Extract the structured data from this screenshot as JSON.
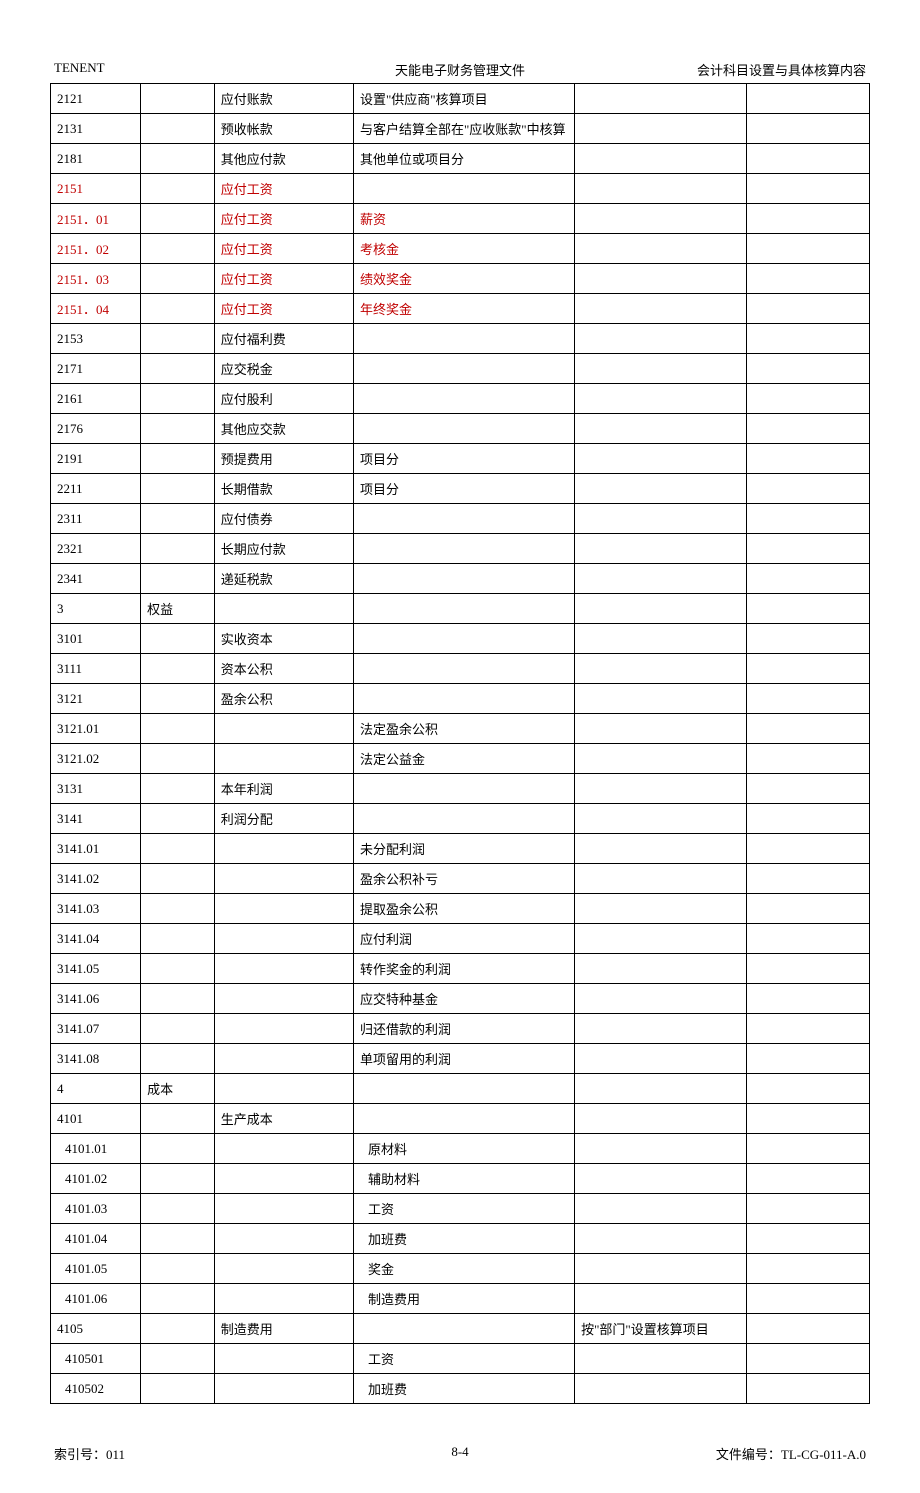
{
  "header": {
    "left": "TENENT",
    "center": "天能电子财务管理文件",
    "right": "会计科目设置与具体核算内容"
  },
  "footer": {
    "left": "索引号：011",
    "center": "8-4",
    "right": "文件编号：TL-CG-011-A.0"
  },
  "rows": [
    {
      "code": "2121",
      "cat": "",
      "name": "应付账款",
      "detail": "设置\"供应商\"核算项目",
      "note": "",
      "blank": ""
    },
    {
      "code": "2131",
      "cat": "",
      "name": "预收帐款",
      "detail": "与客户结算全部在\"应收账款\"中核算",
      "note": "",
      "blank": ""
    },
    {
      "code": "2181",
      "cat": "",
      "name": "其他应付款",
      "detail": "其他单位或项目分",
      "note": "",
      "blank": ""
    },
    {
      "code": "2151",
      "cat": "",
      "name": "应付工资",
      "detail": "",
      "note": "",
      "blank": "",
      "red": true
    },
    {
      "code": "2151．01",
      "cat": "",
      "name": "应付工资",
      "detail": "薪资",
      "note": "",
      "blank": "",
      "red": true
    },
    {
      "code": "2151．02",
      "cat": "",
      "name": "应付工资",
      "detail": "考核金",
      "note": "",
      "blank": "",
      "red": true
    },
    {
      "code": "2151．03",
      "cat": "",
      "name": "应付工资",
      "detail": "绩效奖金",
      "note": "",
      "blank": "",
      "red": true
    },
    {
      "code": "2151．04",
      "cat": "",
      "name": "应付工资",
      "detail": "年终奖金",
      "note": "",
      "blank": "",
      "red": true
    },
    {
      "code": "2153",
      "cat": "",
      "name": "应付福利费",
      "detail": "",
      "note": "",
      "blank": ""
    },
    {
      "code": "2171",
      "cat": "",
      "name": "应交税金",
      "detail": "",
      "note": "",
      "blank": ""
    },
    {
      "code": "2161",
      "cat": "",
      "name": "应付股利",
      "detail": "",
      "note": "",
      "blank": ""
    },
    {
      "code": "2176",
      "cat": "",
      "name": "其他应交款",
      "detail": "",
      "note": "",
      "blank": ""
    },
    {
      "code": "2191",
      "cat": "",
      "name": "预提费用",
      "detail": "项目分",
      "note": "",
      "blank": ""
    },
    {
      "code": "2211",
      "cat": "",
      "name": "长期借款",
      "detail": "项目分",
      "note": "",
      "blank": ""
    },
    {
      "code": "2311",
      "cat": "",
      "name": "应付债券",
      "detail": "",
      "note": "",
      "blank": ""
    },
    {
      "code": "2321",
      "cat": "",
      "name": "长期应付款",
      "detail": "",
      "note": "",
      "blank": ""
    },
    {
      "code": "2341",
      "cat": "",
      "name": "递延税款",
      "detail": "",
      "note": "",
      "blank": ""
    },
    {
      "code": "3",
      "cat": "权益",
      "name": "",
      "detail": "",
      "note": "",
      "blank": ""
    },
    {
      "code": "3101",
      "cat": "",
      "name": "实收资本",
      "detail": "",
      "note": "",
      "blank": ""
    },
    {
      "code": "3111",
      "cat": "",
      "name": "资本公积",
      "detail": "",
      "note": "",
      "blank": ""
    },
    {
      "code": "3121",
      "cat": "",
      "name": "盈余公积",
      "detail": "",
      "note": "",
      "blank": ""
    },
    {
      "code": "3121.01",
      "cat": "",
      "name": "",
      "detail": "法定盈余公积",
      "note": "",
      "blank": ""
    },
    {
      "code": "3121.02",
      "cat": "",
      "name": "",
      "detail": "法定公益金",
      "note": "",
      "blank": ""
    },
    {
      "code": "3131",
      "cat": "",
      "name": "本年利润",
      "detail": "",
      "note": "",
      "blank": ""
    },
    {
      "code": "3141",
      "cat": "",
      "name": "利润分配",
      "detail": "",
      "note": "",
      "blank": ""
    },
    {
      "code": "3141.01",
      "cat": "",
      "name": "",
      "detail": "未分配利润",
      "note": "",
      "blank": ""
    },
    {
      "code": "3141.02",
      "cat": "",
      "name": "",
      "detail": "盈余公积补亏",
      "note": "",
      "blank": ""
    },
    {
      "code": "3141.03",
      "cat": "",
      "name": "",
      "detail": "提取盈余公积",
      "note": "",
      "blank": ""
    },
    {
      "code": "3141.04",
      "cat": "",
      "name": "",
      "detail": "应付利润",
      "note": "",
      "blank": ""
    },
    {
      "code": "3141.05",
      "cat": "",
      "name": "",
      "detail": "转作奖金的利润",
      "note": "",
      "blank": ""
    },
    {
      "code": "3141.06",
      "cat": "",
      "name": "",
      "detail": "应交特种基金",
      "note": "",
      "blank": ""
    },
    {
      "code": "3141.07",
      "cat": "",
      "name": "",
      "detail": "归还借款的利润",
      "note": "",
      "blank": ""
    },
    {
      "code": "3141.08",
      "cat": "",
      "name": "",
      "detail": "单项留用的利润",
      "note": "",
      "blank": ""
    },
    {
      "code": "4",
      "cat": "成本",
      "name": "",
      "detail": "",
      "note": "",
      "blank": ""
    },
    {
      "code": "4101",
      "cat": "",
      "name": "生产成本",
      "detail": "",
      "note": "",
      "blank": ""
    },
    {
      "code": "4101.01",
      "cat": "",
      "name": "",
      "detail": "原材料",
      "note": "",
      "blank": "",
      "indent": true
    },
    {
      "code": "4101.02",
      "cat": "",
      "name": "",
      "detail": "辅助材料",
      "note": "",
      "blank": "",
      "indent": true
    },
    {
      "code": "4101.03",
      "cat": "",
      "name": "",
      "detail": "工资",
      "note": "",
      "blank": "",
      "indent": true
    },
    {
      "code": "4101.04",
      "cat": "",
      "name": "",
      "detail": "加班费",
      "note": "",
      "blank": "",
      "indent": true
    },
    {
      "code": "4101.05",
      "cat": "",
      "name": "",
      "detail": "奖金",
      "note": "",
      "blank": "",
      "indent": true
    },
    {
      "code": "4101.06",
      "cat": "",
      "name": "",
      "detail": "制造费用",
      "note": "",
      "blank": "",
      "indent": true
    },
    {
      "code": "4105",
      "cat": "",
      "name": "制造费用",
      "detail": "",
      "note": "按\"部门\"设置核算项目",
      "blank": ""
    },
    {
      "code": "410501",
      "cat": "",
      "name": "",
      "detail": "工资",
      "note": "",
      "blank": "",
      "indent": true
    },
    {
      "code": "410502",
      "cat": "",
      "name": "",
      "detail": "加班费",
      "note": "",
      "blank": "",
      "indent": true
    }
  ]
}
